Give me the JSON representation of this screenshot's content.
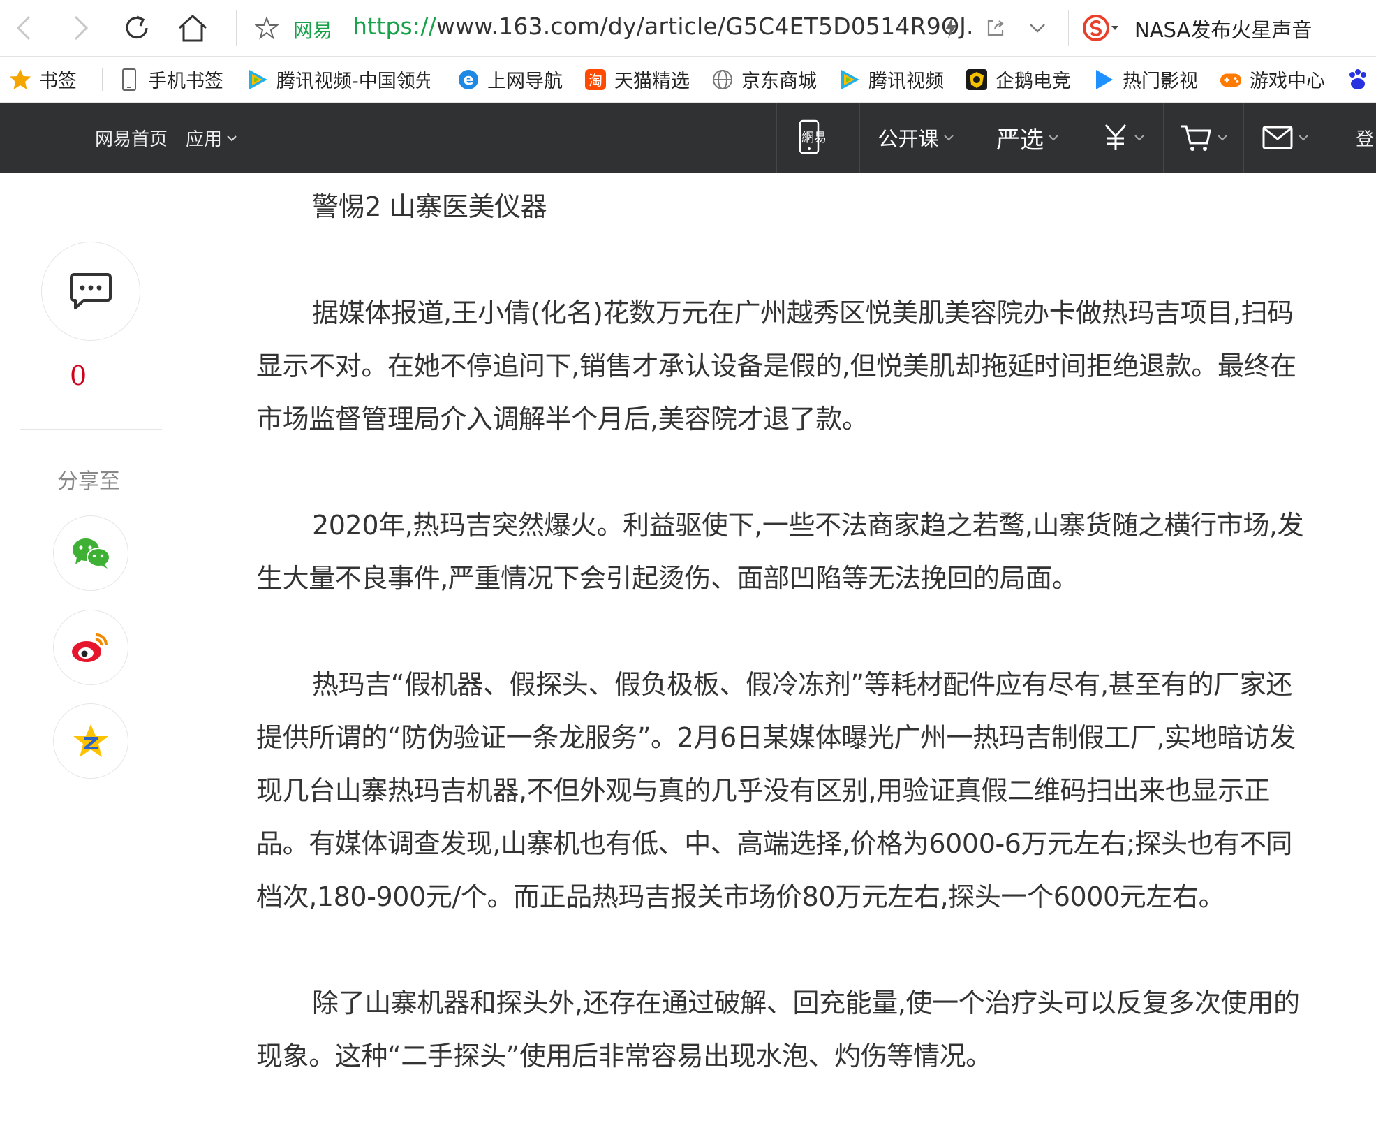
{
  "browser": {
    "site_label": "网易",
    "url_scheme": "https://",
    "url_rest": "www.163.com/dy/article/G5C4ET5D0514R9OJ.",
    "search_text": "NASA发布火星声音"
  },
  "bookmarks": [
    {
      "label": "书签",
      "icon": "star-icon"
    },
    {
      "label": "手机书签",
      "icon": "phone-icon"
    },
    {
      "label": "腾讯视频-中国领先",
      "icon": "tencent-video-icon"
    },
    {
      "label": "上网导航",
      "icon": "ie-icon"
    },
    {
      "label": "天猫精选",
      "icon": "taobao-icon"
    },
    {
      "label": "京东商城",
      "icon": "globe-icon"
    },
    {
      "label": "腾讯视频",
      "icon": "tencent-video-icon"
    },
    {
      "label": "企鹅电竞",
      "icon": "penguin-esports-icon"
    },
    {
      "label": "热门影视",
      "icon": "play-icon"
    },
    {
      "label": "游戏中心",
      "icon": "gamepad-icon"
    }
  ],
  "site_header": {
    "home": "网易首页",
    "apps": "应用",
    "open_course": "公开课",
    "yanxuan": "严选",
    "login": "登"
  },
  "sidebar": {
    "comment_count": "0",
    "share_label": "分享至"
  },
  "article": {
    "heading": "警惕2 山寨医美仪器",
    "paragraphs": [
      "据媒体报道,王小倩(化名)花数万元在广州越秀区悦美肌美容院办卡做热玛吉项目,扫码显示不对。在她不停追问下,销售才承认设备是假的,但悦美肌却拖延时间拒绝退款。最终在市场监督管理局介入调解半个月后,美容院才退了款。",
      "2020年,热玛吉突然爆火。利益驱使下,一些不法商家趋之若鹜,山寨货随之横行市场,发生大量不良事件,严重情况下会引起烫伤、面部凹陷等无法挽回的局面。",
      "热玛吉“假机器、假探头、假负极板、假冷冻剂”等耗材配件应有尽有,甚至有的厂家还提供所谓的“防伪验证一条龙服务”。2月6日某媒体曝光广州一热玛吉制假工厂,实地暗访发现几台山寨热玛吉机器,不但外观与真的几乎没有区别,用验证真假二维码扫出来也显示正品。有媒体调查发现,山寨机也有低、中、高端选择,价格为6000-6万元左右;探头也有不同档次,180-900元/个。而正品热玛吉报关市场价80万元左右,探头一个6000元左右。",
      "除了山寨机器和探头外,还存在通过破解、回充能量,使一个治疗头可以反复多次使用的现象。这种“二手探头”使用后非常容易出现水泡、灼伤等情况。"
    ]
  }
}
